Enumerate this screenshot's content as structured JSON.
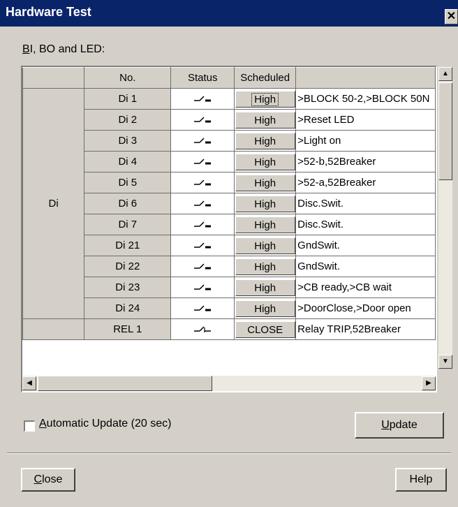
{
  "window": {
    "title": "Hardware Test",
    "close_glyph": "✕"
  },
  "group_label": {
    "prefix": "B",
    "rest": "I, BO and LED:"
  },
  "grid": {
    "headers": {
      "group": "",
      "no": "No.",
      "status": "Status",
      "scheduled": "Scheduled",
      "description": ""
    },
    "group_label": "Di",
    "rows": [
      {
        "no": "Di 1",
        "status_icon": "switch-open-icon",
        "scheduled": "High",
        "description": ">BLOCK 50-2,>BLOCK 50N"
      },
      {
        "no": "Di 2",
        "status_icon": "switch-open-icon",
        "scheduled": "High",
        "description": ">Reset LED"
      },
      {
        "no": "Di 3",
        "status_icon": "switch-open-icon",
        "scheduled": "High",
        "description": ">Light on"
      },
      {
        "no": "Di 4",
        "status_icon": "switch-open-icon",
        "scheduled": "High",
        "description": ">52-b,52Breaker"
      },
      {
        "no": "Di 5",
        "status_icon": "switch-open-icon",
        "scheduled": "High",
        "description": ">52-a,52Breaker"
      },
      {
        "no": "Di 6",
        "status_icon": "switch-open-icon",
        "scheduled": "High",
        "description": "Disc.Swit."
      },
      {
        "no": "Di 7",
        "status_icon": "switch-open-icon",
        "scheduled": "High",
        "description": "Disc.Swit."
      },
      {
        "no": "Di 21",
        "status_icon": "switch-open-icon",
        "scheduled": "High",
        "description": "GndSwit."
      },
      {
        "no": "Di 22",
        "status_icon": "switch-open-icon",
        "scheduled": "High",
        "description": "GndSwit."
      },
      {
        "no": "Di 23",
        "status_icon": "switch-open-icon",
        "scheduled": "High",
        "description": ">CB ready,>CB wait"
      },
      {
        "no": "Di 24",
        "status_icon": "switch-open-icon",
        "scheduled": "High",
        "description": ">DoorClose,>Door open"
      },
      {
        "no": "REL 1",
        "status_icon": "relay-open-icon",
        "scheduled": "CLOSE",
        "description": "Relay TRIP,52Breaker"
      }
    ]
  },
  "auto_update": {
    "label": "Automatic Update (20 sec)",
    "checked": false
  },
  "buttons": {
    "update": "Update",
    "close": "Close",
    "help": "Help"
  }
}
